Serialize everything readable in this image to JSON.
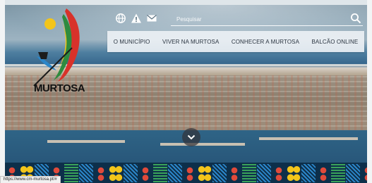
{
  "brand": {
    "name": "MURTOSA",
    "colors": {
      "red": "#d8322a",
      "green": "#2e8b3e",
      "yellow": "#f3c51a",
      "navy": "#0d2f4a"
    }
  },
  "utility": {
    "icons": [
      "globe-icon",
      "warning-icon",
      "mail-icon"
    ],
    "search": {
      "placeholder": "Pesquisar",
      "value": "",
      "icon": "search-icon"
    }
  },
  "nav": {
    "items": [
      {
        "label": "O MUNICÍPIO"
      },
      {
        "label": "VIVER NA MURTOSA"
      },
      {
        "label": "CONHECER A MURTOSA"
      },
      {
        "label": "BALCÃO ONLINE"
      }
    ]
  },
  "hero": {
    "scroll_icon": "chevron-down-icon"
  },
  "status_bar": {
    "url": "https://www.cm-murtosa.pt/#"
  }
}
